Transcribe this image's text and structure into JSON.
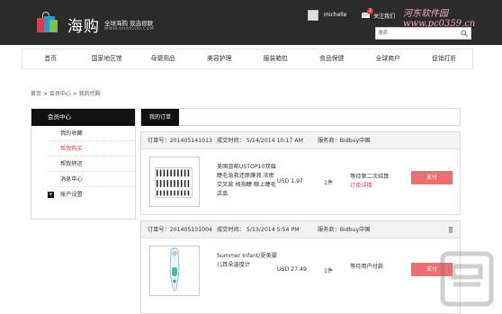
{
  "header": {
    "brand": "海购",
    "slogan": "全球海购 我选很联",
    "site_url": "WWW.UHAIGOU.COM",
    "username": "michelle",
    "mail_count": "2",
    "follow_link": "关注我们",
    "watermark": "河东软件园 www.pc0359.cn",
    "search_placeholder": "搜索",
    "icons": {
      "logo": "shopping-bags-logo",
      "avatar": "user-avatar",
      "mail": "mail-icon",
      "search": "search-icon"
    }
  },
  "nav": {
    "items": [
      "首页",
      "国家地区馆",
      "母婴用品",
      "美容护理",
      "服装箱包",
      "食品保健",
      "全球商户",
      "促销打折"
    ]
  },
  "breadcrumb": "首页 > 会员中心 > 我的代购",
  "sidebar": {
    "title": "会员中心",
    "items": [
      "我的收藏",
      "帮我购买",
      "帮我转运",
      "消息中心"
    ],
    "active_index": 1,
    "expand_item": "账户设置",
    "accent_color": "#e84a58"
  },
  "main": {
    "tab_label": "我的订单",
    "orders": [
      {
        "order_no": "订单号：201405141013",
        "time": "成交时间： 5/14/2014 10:17 AM",
        "service": "服务商：Bidbuy中国",
        "product_name": "美国直邮USTOP10双眉睫毛急救还原膜液 浓密交叉款 拇指睫 眼上睫毛正品",
        "price": "USD 1.97",
        "qty": "1件",
        "status": "等待第二次结算",
        "status_link": "订单详情",
        "pay_label": "支付"
      },
      {
        "order_no": "订单号：201405131004",
        "time": "成交时间： 5/13/2014 5:54 PM",
        "service": "服务商：Bidbuy中国",
        "product_name": "Summer Infant/夏美婴儿耳朵温度计",
        "price": "USD 27.49",
        "qty": "1件",
        "status": "等待用户付款",
        "pay_label": "支付"
      }
    ]
  },
  "colors": {
    "header_bg": "#2b2b2b",
    "pay_button": "#ee6e74",
    "accent": "#e84a58"
  }
}
